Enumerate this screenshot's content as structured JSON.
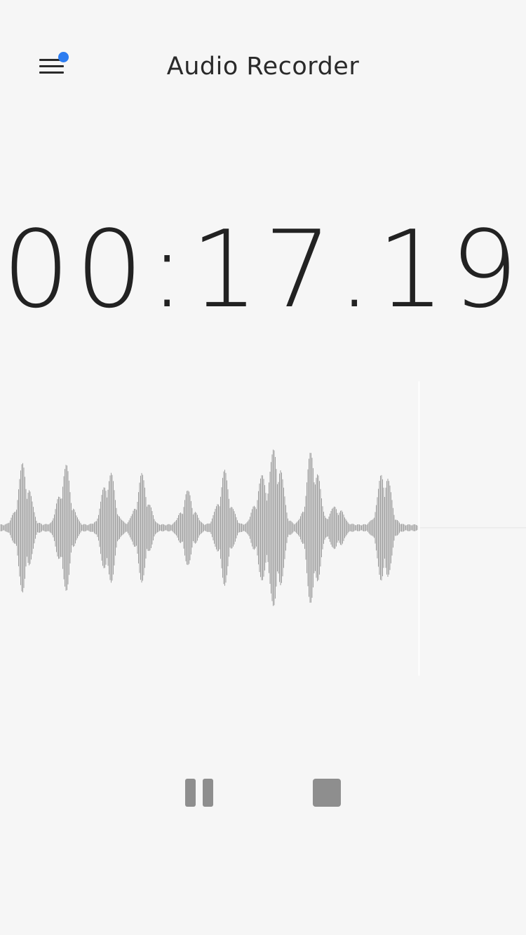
{
  "header": {
    "title": "Audio Recorder",
    "menu_icon": "hamburger-menu-icon",
    "notification_color": "#2c7cf0"
  },
  "recorder": {
    "elapsed_time": "00:17.19",
    "state": "recording"
  },
  "waveform": {
    "color": "#8a8a8a",
    "playhead_color": "#ffffff",
    "baseline_color": "#e4e4e4"
  },
  "controls": {
    "pause_icon": "pause-icon",
    "stop_icon": "stop-icon",
    "icon_color": "#8e8e8e"
  }
}
